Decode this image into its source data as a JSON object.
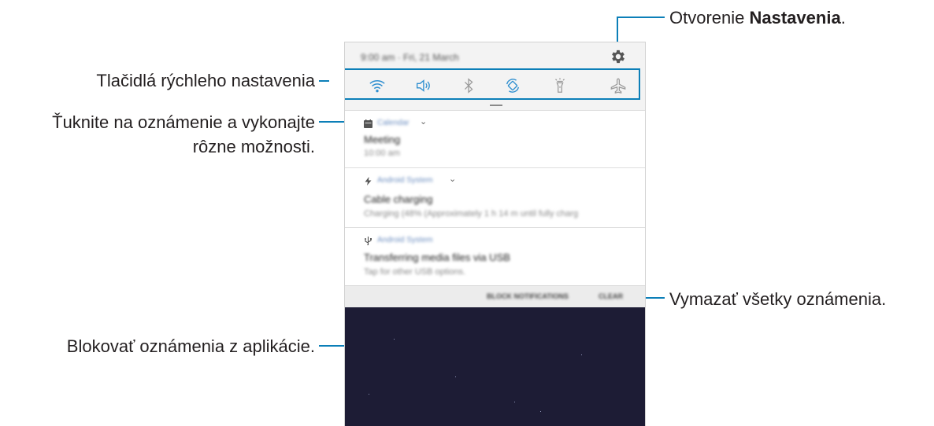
{
  "callouts": {
    "settings_prefix": "Otvorenie ",
    "settings_bold": "Nastavenia",
    "settings_suffix": ".",
    "quick_settings": "Tlačidlá rýchleho nastavenia",
    "tap_notification_line1": "Ťuknite na oznámenie a vykonajte",
    "tap_notification_line2": "rôzne možnosti.",
    "clear_all": "Vymazať všetky oznámenia.",
    "block_notifications": "Blokovať oznámenia z aplikácie."
  },
  "panel": {
    "status_text": "9:00 am · Fri, 21 March",
    "quick_settings_icons": [
      "wifi-icon",
      "sound-icon",
      "bluetooth-icon",
      "auto-rotate-icon",
      "flashlight-icon",
      "airplane-mode-icon"
    ],
    "accent_color": "#0c7fb8",
    "notifications": [
      {
        "app": "Calendar",
        "title": "Meeting",
        "subtitle": "10:00 am"
      },
      {
        "app": "Android System",
        "title": "Cable charging",
        "subtitle": "Charging (48% (Approximately 1 h 14 m until fully charg"
      },
      {
        "app": "Android System",
        "title": "Transferring media files via USB",
        "subtitle": "Tap for other USB options."
      }
    ],
    "actions": {
      "block": "BLOCK NOTIFICATIONS",
      "clear": "CLEAR"
    }
  }
}
